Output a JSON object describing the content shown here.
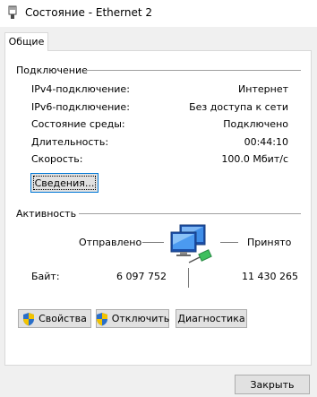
{
  "window": {
    "title": "Состояние - Ethernet 2"
  },
  "tabs": [
    {
      "label": "Общие"
    }
  ],
  "connection": {
    "heading": "Подключение",
    "rows": [
      {
        "label": "IPv4-подключение:",
        "value": "Интернет"
      },
      {
        "label": "IPv6-подключение:",
        "value": "Без доступа к сети"
      },
      {
        "label": "Состояние среды:",
        "value": "Подключено"
      },
      {
        "label": "Длительность:",
        "value": "00:44:10"
      },
      {
        "label": "Скорость:",
        "value": "100.0 Мбит/с"
      }
    ],
    "details_button": "Сведения..."
  },
  "activity": {
    "heading": "Активность",
    "sent_label": "Отправлено",
    "received_label": "Принято",
    "bytes_label": "Байт:",
    "bytes_sent": "6 097 752",
    "bytes_received": "11 430 265",
    "icon": "network-computers-icon"
  },
  "buttons": {
    "properties": "Свойства",
    "disable": "Отключить",
    "diagnose": "Диагностика",
    "close": "Закрыть"
  },
  "colors": {
    "accent": "#0078d7",
    "shield_blue": "#2a6fc9",
    "shield_yellow": "#f2c300"
  }
}
